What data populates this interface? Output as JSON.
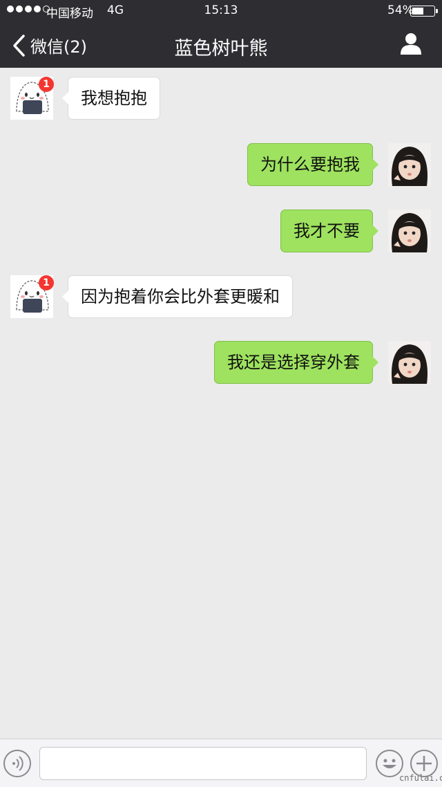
{
  "status_bar": {
    "carrier": "中国移动",
    "network": "4G",
    "time": "15:13",
    "battery_text": "54%",
    "battery_level": 0.54,
    "signal_bars_filled": 4,
    "signal_bars_total": 5
  },
  "nav": {
    "back_label": "微信(2)",
    "title": "蓝色树叶熊",
    "back_icon": "chevron-left-icon",
    "profile_icon": "person-icon"
  },
  "messages": [
    {
      "side": "left",
      "text": "我想抱抱",
      "badge": "1"
    },
    {
      "side": "right",
      "text": "为什么要抱我"
    },
    {
      "side": "right",
      "text": "我才不要"
    },
    {
      "side": "left",
      "text": "因为抱着你会比外套更暖和",
      "badge": "1"
    },
    {
      "side": "right",
      "text": "我还是选择穿外套"
    }
  ],
  "input_bar": {
    "voice_icon": "voice-icon",
    "emoji_icon": "emoji-icon",
    "plus_icon": "plus-icon",
    "text_value": ""
  },
  "watermark": "cnfulai.cn",
  "colors": {
    "header_bg": "#2e2e32",
    "chat_bg": "#ebebeb",
    "bubble_mine": "#9ee25f",
    "bubble_other": "#ffffff",
    "badge": "#f43530"
  }
}
